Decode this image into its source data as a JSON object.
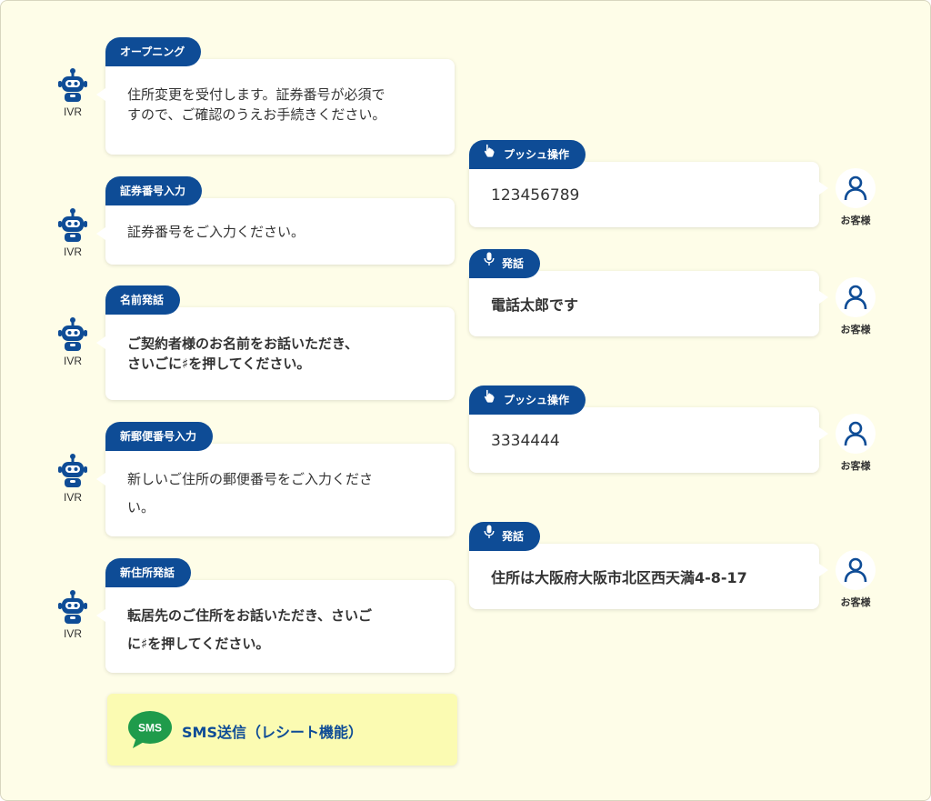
{
  "colors": {
    "background": "#fefde8",
    "tag": "#0e4c96",
    "sms_green": "#1f9b4b",
    "sms_box": "#fbfbb2"
  },
  "ivr_label": "IVR",
  "customer_label": "お客様",
  "ivr_steps": [
    {
      "tag": "オープニング",
      "lines": [
        "住所変更を受付します。証券番号が必須で",
        "すので、ご確認のうえお手続きください。"
      ]
    },
    {
      "tag": "証券番号入力",
      "lines": [
        "証券番号をご入力ください。"
      ]
    },
    {
      "tag": "名前発話",
      "lines": [
        "ご契約者様のお名前をお話いただき、",
        "さいごに♯を押してください。"
      ]
    },
    {
      "tag": "新郵便番号入力",
      "lines": [
        "新しいご住所の郵便番号をご入力くださ",
        "い。"
      ]
    },
    {
      "tag": "新住所発話",
      "lines": [
        "転居先のご住所をお話いただき、さいご",
        "に♯を押してください。"
      ]
    }
  ],
  "customer_responses": [
    {
      "tag": "プッシュ操作",
      "icon": "hand-pointer-icon",
      "text": "123456789"
    },
    {
      "tag": "発話",
      "icon": "microphone-icon",
      "text": "電話太郎です"
    },
    {
      "tag": "プッシュ操作",
      "icon": "hand-pointer-icon",
      "text": "3334444"
    },
    {
      "tag": "発話",
      "icon": "microphone-icon",
      "text": "住所は大阪府大阪市北区西天満4-8-17"
    }
  ],
  "sms": {
    "badge": "SMS",
    "text": "SMS送信（レシート機能）"
  }
}
